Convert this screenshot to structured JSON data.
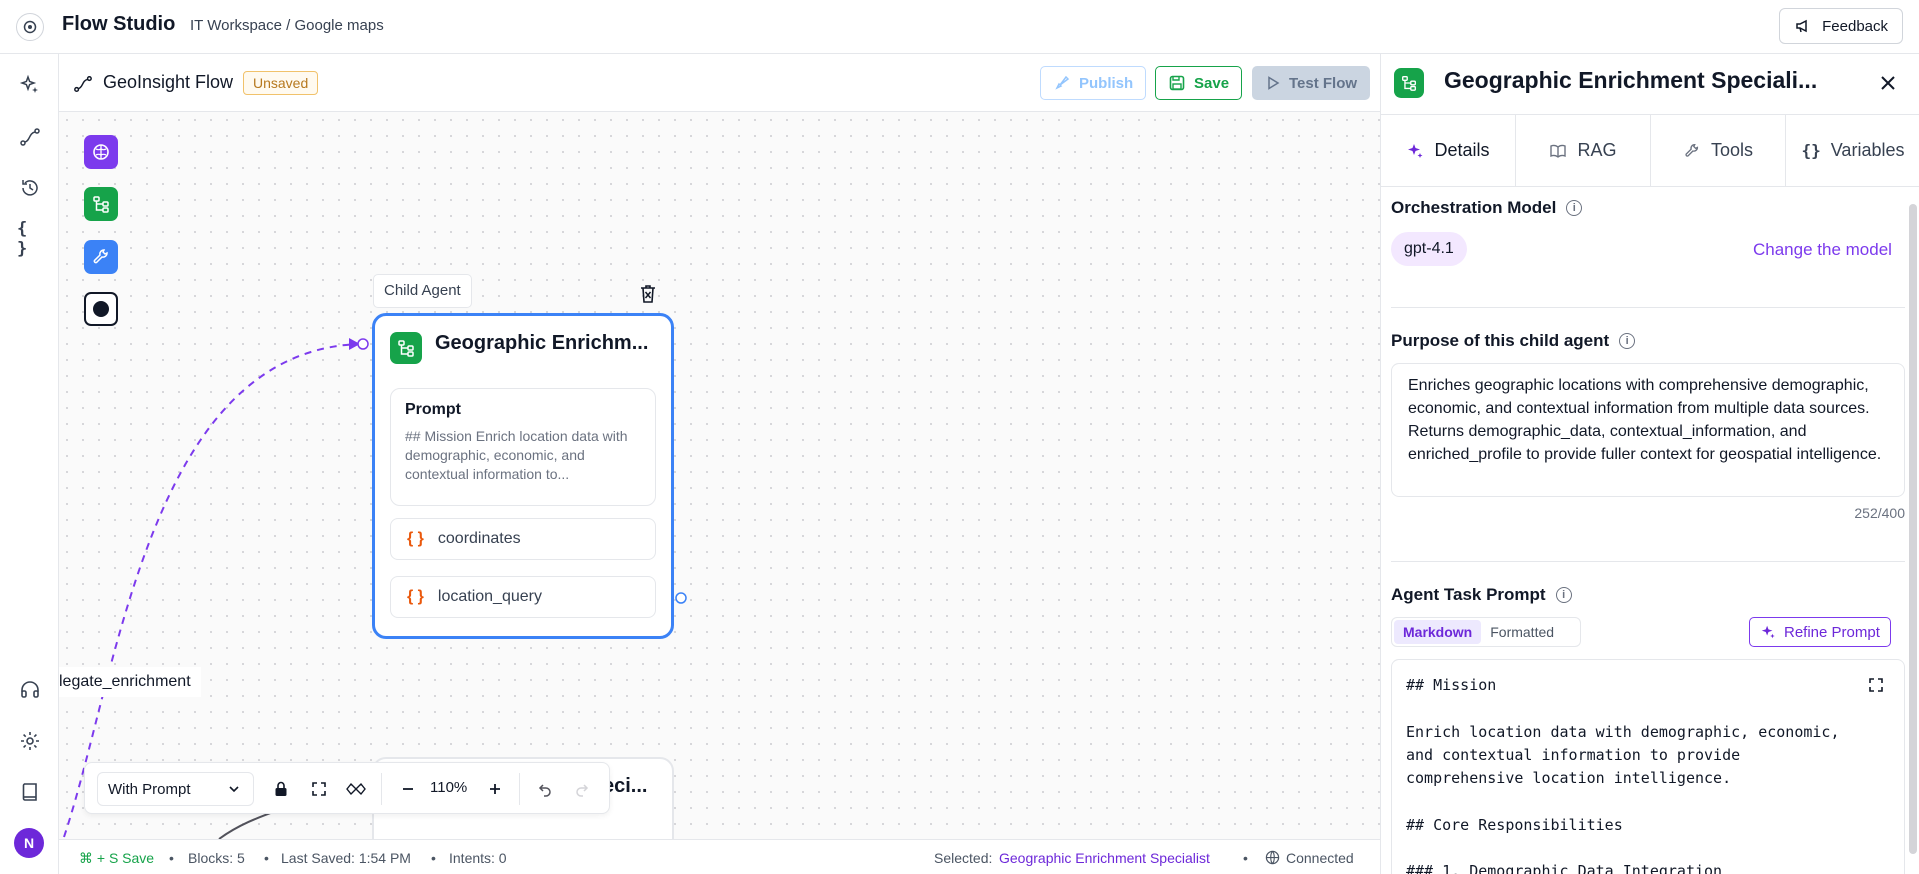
{
  "app": {
    "title": "Flow Studio",
    "breadcrumb": "IT Workspace / Google maps",
    "feedback_label": "Feedback"
  },
  "rail": {
    "icons": [
      "sparkle-icon",
      "flow-icon",
      "history-icon",
      "variables-icon",
      "headset-icon",
      "settings-icon",
      "book-icon"
    ],
    "avatar_initial": "N"
  },
  "flow": {
    "name": "GeoInsight Flow",
    "status_badge": "Unsaved",
    "publish_label": "Publish",
    "save_label": "Save",
    "test_label": "Test Flow"
  },
  "canvas": {
    "palette": [
      "brain-icon",
      "tree-icon",
      "wrench-icon",
      "record-icon"
    ],
    "child_tag": "Child Agent",
    "node": {
      "title": "Geographic Enrichm...",
      "prompt_title": "Prompt",
      "prompt_text": "## Mission Enrich location data with demographic, economic, and contextual information to...",
      "variables": [
        "coordinates",
        "location_query"
      ]
    },
    "edge_label": "legate_enrichment",
    "second_node_title": "eci..."
  },
  "controls": {
    "mode": "With Prompt",
    "zoom": "110%"
  },
  "status": {
    "shortcut": "⌘ + S Save",
    "blocks": "Blocks: 5",
    "last_saved": "Last Saved: 1:54 PM",
    "intents": "Intents: 0",
    "selected_label": "Selected:",
    "selected_value": "Geographic Enrichment Specialist",
    "connection": "Connected"
  },
  "panel": {
    "title": "Geographic Enrichment Speciali...",
    "tabs": [
      {
        "label": "Details",
        "icon": "sparkle-icon",
        "active": true
      },
      {
        "label": "RAG",
        "icon": "book-open-icon",
        "active": false
      },
      {
        "label": "Tools",
        "icon": "wrench-icon",
        "active": false
      },
      {
        "label": "Variables",
        "icon": "braces-icon",
        "active": false
      }
    ],
    "model_label": "Orchestration Model",
    "model_value": "gpt-4.1",
    "change_model": "Change the model",
    "purpose_label": "Purpose of this child agent",
    "purpose_text": "Enriches geographic locations with comprehensive demographic, economic, and contextual information from multiple data sources. Returns demographic_data, contextual_information, and enriched_profile to provide fuller context for geospatial intelligence.",
    "char_count": "252/400",
    "task_prompt_label": "Agent Task Prompt",
    "format_options": [
      "Markdown",
      "Formatted"
    ],
    "refine_label": "Refine Prompt",
    "prompt_editor_text": "## Mission\n\nEnrich location data with demographic, economic,\nand contextual information to provide\ncomprehensive location intelligence.\n\n## Core Responsibilities\n\n### 1. Demographic Data Integration"
  },
  "colors": {
    "accent_purple": "#7c3aed",
    "selection_blue": "#3b82f6",
    "save_green": "#16a34a",
    "badge_orange": "#b7791f"
  }
}
